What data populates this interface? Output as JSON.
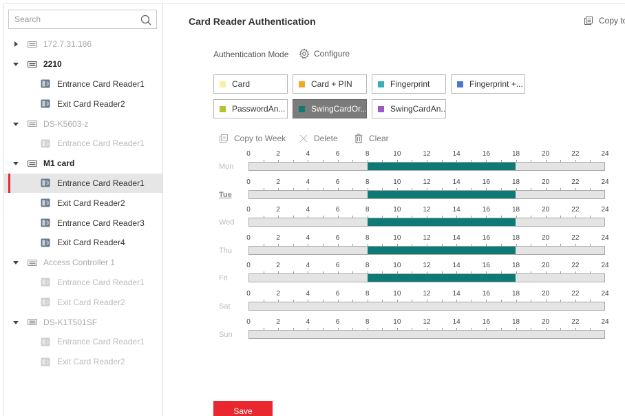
{
  "search": {
    "placeholder": "Search"
  },
  "tree": [
    {
      "label": "172.7.31.186",
      "level": 0,
      "expanded": false,
      "type": "device",
      "style": "muted"
    },
    {
      "label": "2210",
      "level": 0,
      "expanded": true,
      "type": "device",
      "style": "bold"
    },
    {
      "label": "Entrance Card Reader1",
      "level": 1,
      "type": "reader",
      "style": "normal"
    },
    {
      "label": "Exit Card Reader2",
      "level": 1,
      "type": "reader",
      "style": "normal"
    },
    {
      "label": "DS-K5603-z",
      "level": 0,
      "expanded": true,
      "type": "device",
      "style": "muted"
    },
    {
      "label": "Entrance Card Reader1",
      "level": 1,
      "type": "reader",
      "style": "dim"
    },
    {
      "label": "M1 card",
      "level": 0,
      "expanded": true,
      "type": "device",
      "style": "bold"
    },
    {
      "label": "Entrance Card Reader1",
      "level": 1,
      "type": "reader",
      "style": "normal",
      "selected": true
    },
    {
      "label": "Exit Card Reader2",
      "level": 1,
      "type": "reader",
      "style": "normal"
    },
    {
      "label": "Entrance Card Reader3",
      "level": 1,
      "type": "reader",
      "style": "normal"
    },
    {
      "label": "Exit Card Reader4",
      "level": 1,
      "type": "reader",
      "style": "normal"
    },
    {
      "label": "Access Controller 1",
      "level": 0,
      "expanded": true,
      "type": "device",
      "style": "muted"
    },
    {
      "label": "Entrance Card Reader1",
      "level": 1,
      "type": "reader",
      "style": "dim"
    },
    {
      "label": "Exit Card Reader2",
      "level": 1,
      "type": "reader",
      "style": "dim"
    },
    {
      "label": "DS-K1T501SF",
      "level": 0,
      "expanded": true,
      "type": "device",
      "style": "muted"
    },
    {
      "label": "Entrance Card Reader1",
      "level": 1,
      "type": "reader",
      "style": "dim"
    },
    {
      "label": "Exit Card Reader2",
      "level": 1,
      "type": "reader",
      "style": "dim"
    }
  ],
  "main": {
    "title": "Card Reader Authentication",
    "copy_to": "Copy to",
    "auth_mode_label": "Authentication Mode",
    "configure_label": "Configure",
    "modes": [
      {
        "label": "Card",
        "color": "#f7f1a6",
        "active": false
      },
      {
        "label": "Card + PIN",
        "color": "#f5a623",
        "active": false
      },
      {
        "label": "Fingerprint",
        "color": "#3aaeb2",
        "active": false
      },
      {
        "label": "Fingerprint +...",
        "color": "#4a78d6",
        "active": false
      },
      {
        "label": "PasswordAn...",
        "color": "#b7c12a",
        "active": false
      },
      {
        "label": "SwingCardOr...",
        "color": "#0e7a76",
        "active": true
      },
      {
        "label": "SwingCardAn...",
        "color": "#9b59c6",
        "active": false
      }
    ],
    "toolbar": {
      "copy_to_week": "Copy to Week",
      "delete": "Delete",
      "clear": "Clear"
    },
    "tick_labels": [
      "0",
      "2",
      "4",
      "6",
      "8",
      "10",
      "12",
      "14",
      "16",
      "18",
      "20",
      "22",
      "24"
    ],
    "schedule": [
      {
        "day": "Mon",
        "current": false,
        "segments": [
          [
            8,
            18
          ]
        ]
      },
      {
        "day": "Tue",
        "current": true,
        "segments": [
          [
            8,
            18
          ]
        ]
      },
      {
        "day": "Wed",
        "current": false,
        "segments": [
          [
            8,
            18
          ]
        ]
      },
      {
        "day": "Thu",
        "current": false,
        "segments": [
          [
            8,
            18
          ]
        ]
      },
      {
        "day": "Fri",
        "current": false,
        "segments": [
          [
            8,
            18
          ]
        ]
      },
      {
        "day": "Sat",
        "current": false,
        "segments": []
      },
      {
        "day": "Sun",
        "current": false,
        "segments": []
      }
    ],
    "save_label": "Save"
  },
  "colors": {
    "accent": "#e8282e",
    "segment": "#0e7a76"
  }
}
